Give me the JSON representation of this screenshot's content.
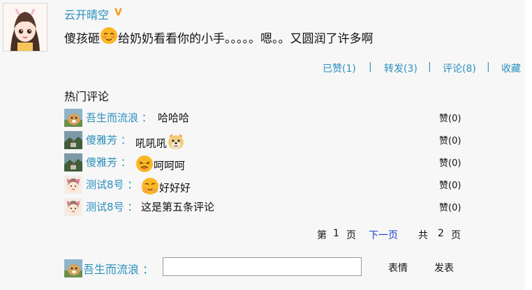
{
  "post": {
    "author": "云开晴空",
    "verified_badge": "V",
    "text_before": "傻孩砸",
    "emoji": "smirk-emoji-icon",
    "text_after": "给奶奶看看你的小手。。。。。嗯。。又圆润了许多啊"
  },
  "actions": {
    "liked": "已赞(1)",
    "repost": "转发(3)",
    "comment": "评论(8)",
    "favorite": "收藏",
    "separator": "|"
  },
  "hot_comments": {
    "title": "热门评论",
    "items": [
      {
        "user": "吾生而流浪",
        "colon": "：",
        "text_before": "哈哈哈",
        "emoji": "",
        "text_after": "",
        "likes": "赞(0)",
        "avatar": "dog-avatar"
      },
      {
        "user": "傻雅芳",
        "colon": "：",
        "text_before": "吼吼吼",
        "emoji": "doge-emoji-icon",
        "text_after": "",
        "likes": "赞(0)",
        "avatar": "landscape-avatar"
      },
      {
        "user": "傻雅芳",
        "colon": "：",
        "text_before": "",
        "emoji": "tired-emoji-icon",
        "text_after": "呵呵呵",
        "likes": "赞(0)",
        "avatar": "landscape-avatar"
      },
      {
        "user": "测试8号",
        "colon": "：",
        "text_before": "",
        "emoji": "laugh-cover-emoji-icon",
        "text_after": "好好好",
        "likes": "赞(0)",
        "avatar": "pink-bow-avatar"
      },
      {
        "user": "测试8号",
        "colon": "：",
        "text_before": "这是第五条评论",
        "emoji": "",
        "text_after": "",
        "likes": "赞(0)",
        "avatar": "pink-bow-avatar"
      }
    ]
  },
  "pagination": {
    "di": "第",
    "current": "1",
    "ye": "页",
    "next": "下一页",
    "gong": "共",
    "total": "2",
    "ye2": "页"
  },
  "compose": {
    "user": "吾生而流浪",
    "colon": "：",
    "value": "",
    "emoji_button": "表情",
    "submit_button": "发表"
  },
  "colors": {
    "link": "#2a8fbd",
    "badge": "#f39a1c",
    "next_link": "#1b3fd1",
    "background": "#f7f7f7"
  }
}
